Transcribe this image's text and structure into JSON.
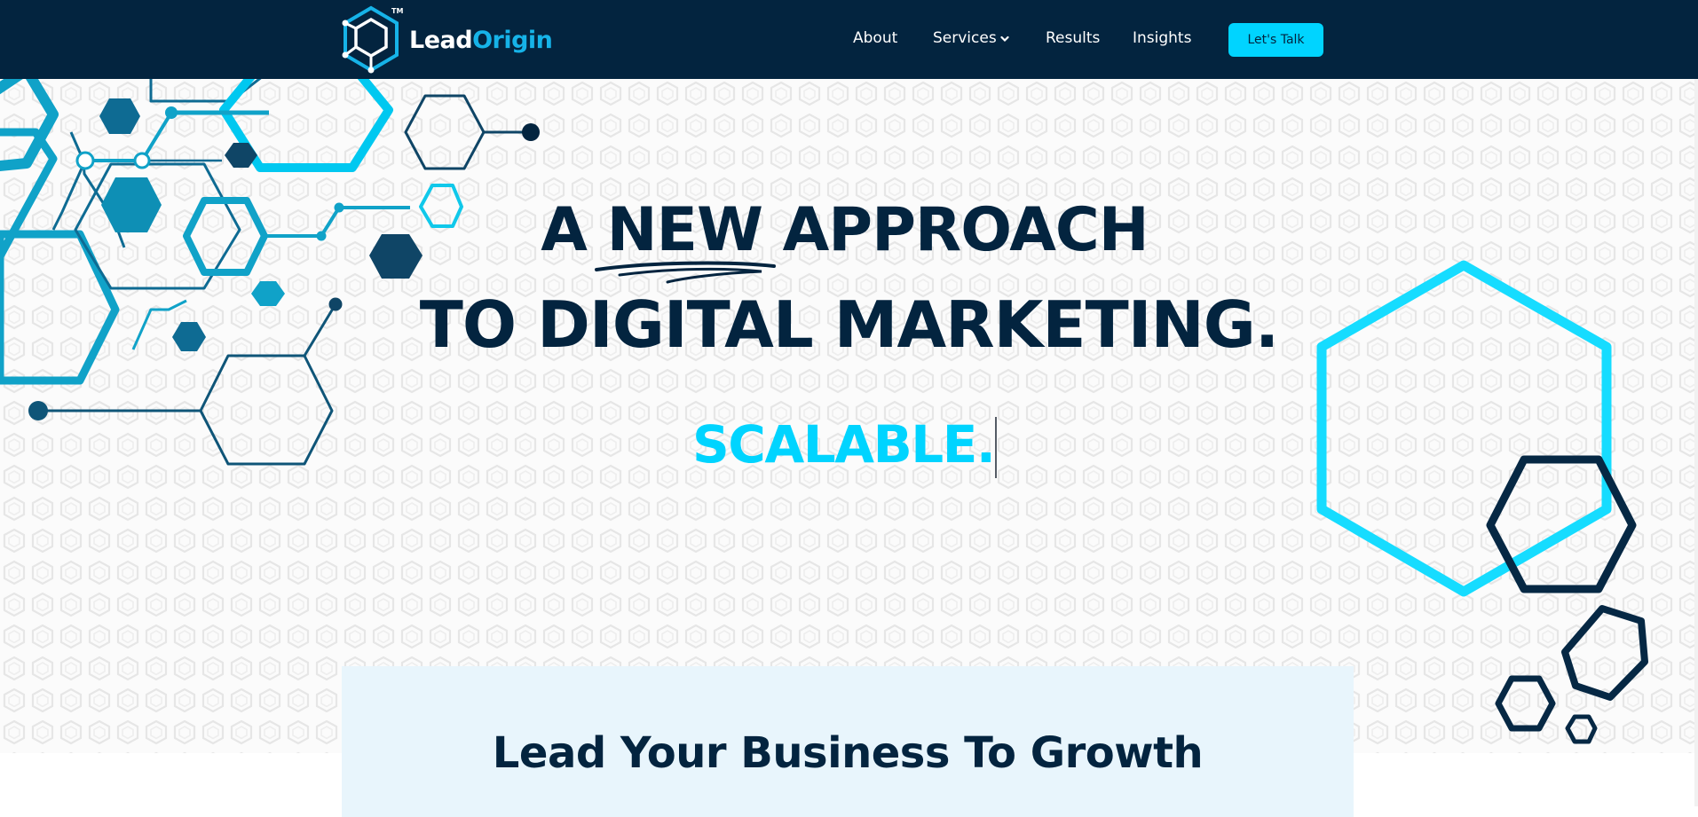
{
  "nav": {
    "logo": {
      "lead": "Lead",
      "origin": "Origin",
      "tm": "TM"
    },
    "links": [
      {
        "label": "About"
      },
      {
        "label": "Services",
        "icon": "chevron-down-icon"
      },
      {
        "label": "Results"
      },
      {
        "label": "Insights"
      }
    ],
    "cta_label": "Let's Talk"
  },
  "hero": {
    "line1_pre": "A ",
    "line1_emph": "NEW",
    "line1_post": " APPROACH",
    "line2": "TO DIGITAL MARKETING.",
    "rotating_word": "SCALABLE."
  },
  "growth": {
    "title": "Lead Your Business To Growth"
  },
  "colors": {
    "navy": "#03243f",
    "cyan": "#00d4ff",
    "teal": "#0e8fb5",
    "panel": "#e8f5fc"
  }
}
